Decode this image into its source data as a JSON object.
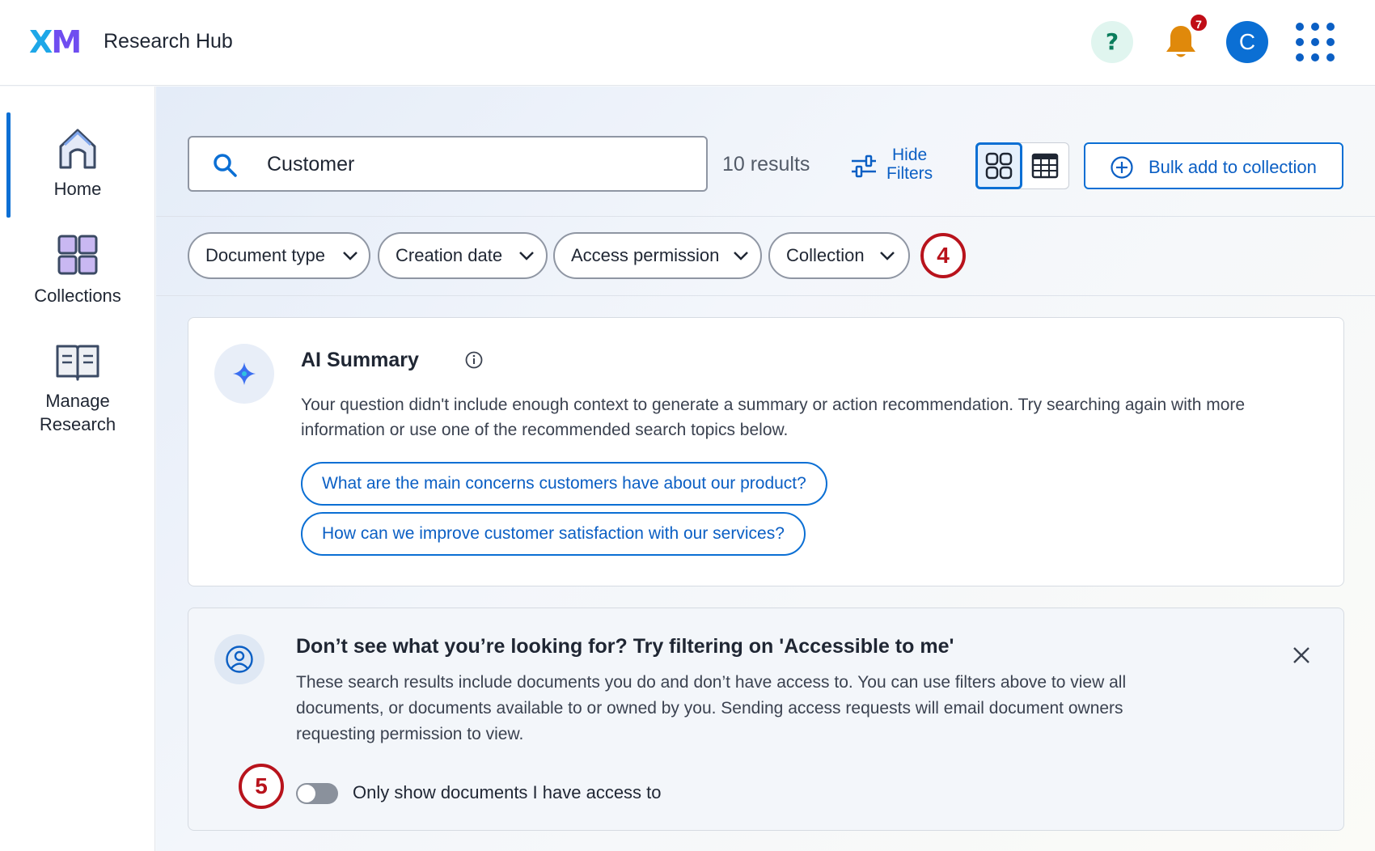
{
  "header": {
    "logo_x": "X",
    "logo_m": "M",
    "app_title": "Research Hub",
    "help_label": "?",
    "notifications_count": "7",
    "avatar_initial": "C"
  },
  "sidebar": {
    "items": [
      {
        "label": "Home",
        "icon": "home-icon",
        "active": true
      },
      {
        "label": "Collections",
        "icon": "collections-icon",
        "active": false
      },
      {
        "label": "Manage Research",
        "icon": "book-icon",
        "active": false
      }
    ]
  },
  "toolbar": {
    "search_value": "Customer",
    "results_text": "10 results",
    "hide_filters_line1": "Hide",
    "hide_filters_line2": "Filters",
    "bulk_add_label": "Bulk add to collection"
  },
  "filters": {
    "chips": [
      "Document type",
      "Creation date",
      "Access permission",
      "Collection"
    ],
    "step_badge": "4"
  },
  "ai_summary": {
    "title": "AI Summary",
    "body": "Your question didn't include enough context to generate a summary or action recommendation. Try searching again with more information or use one of the recommended search topics below.",
    "suggestions": [
      "What are the main concerns customers have about our product?",
      "How can we improve customer satisfaction with our services?"
    ]
  },
  "access_notice": {
    "title": "Don’t see what you’re looking for? Try filtering on 'Accessible to me'",
    "body": "These search results include documents you do and don’t have access to. You can use filters above to view all documents, or documents available to or owned by you. Sending access requests will email document owners requesting permission to view.",
    "toggle_label": "Only show documents I have access to",
    "toggle_on": false,
    "step_badge": "5"
  },
  "colors": {
    "accent": "#0b6fd4",
    "badge_red": "#c00d17",
    "step_red": "#b8131c",
    "bell": "#e0890b"
  }
}
